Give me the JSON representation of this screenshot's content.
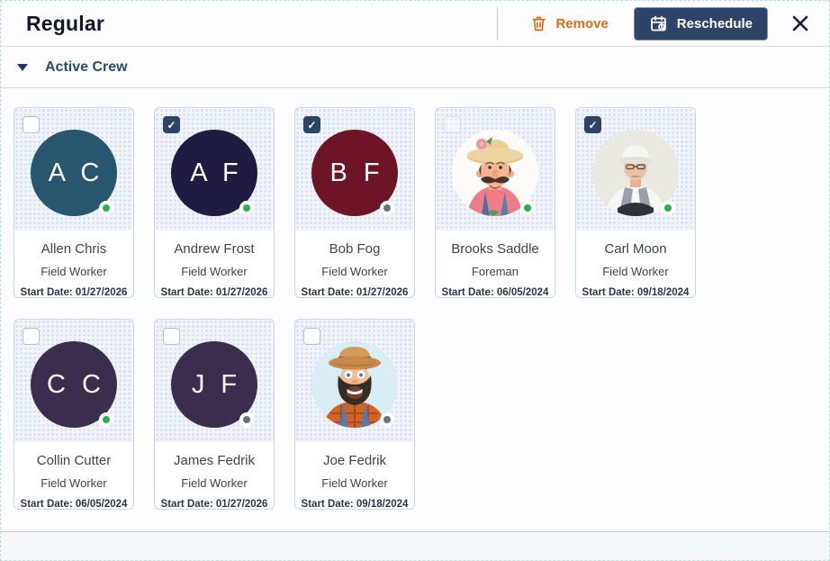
{
  "header": {
    "title": "Regular",
    "remove_label": "Remove",
    "reschedule_label": "Reschedule"
  },
  "section": {
    "title": "Active Crew"
  },
  "icons": {
    "remove": "trash-icon",
    "reschedule": "calendar-clock-icon",
    "close": "close-icon",
    "section_toggle": "chevron-down-icon",
    "check_glyph": "✓"
  },
  "colors": {
    "accent_navy": "#2e4467",
    "remove_orange": "#e5690f",
    "status_online": "#26b343",
    "status_offline": "#68707c",
    "section_title": "#2c4a6e",
    "card_border": "#c8d7e9"
  },
  "crew": [
    {
      "name": "Allen Chris",
      "role": "Field Worker",
      "start_date": "Start Date: 01/27/2026",
      "avatar": "initials",
      "initials": "A C",
      "avatar_color": "#27566e",
      "status": "online",
      "checked": false,
      "checkbox_faded": false
    },
    {
      "name": "Andrew Frost",
      "role": "Field Worker",
      "start_date": "Start Date: 01/27/2026",
      "avatar": "initials",
      "initials": "A F",
      "avatar_color": "#1f1b41",
      "status": "online",
      "checked": true,
      "checkbox_faded": false
    },
    {
      "name": "Bob Fog",
      "role": "Field Worker",
      "start_date": "Start Date: 01/27/2026",
      "avatar": "initials",
      "initials": "B F",
      "avatar_color": "#6d1426",
      "status": "offline",
      "checked": true,
      "checkbox_faded": false
    },
    {
      "name": "Brooks Saddle",
      "role": "Foreman",
      "start_date": "Start Date: 06/05/2024",
      "avatar": "farmer-mustache",
      "initials": "",
      "avatar_color": "#fdfbf8",
      "status": "online",
      "checked": false,
      "checkbox_faded": true
    },
    {
      "name": "Carl Moon",
      "role": "Field Worker",
      "start_date": "Start Date: 09/18/2024",
      "avatar": "hardhat-worker",
      "initials": "",
      "avatar_color": "#e9e9e1",
      "status": "online",
      "checked": true,
      "checkbox_faded": false
    },
    {
      "name": "Collin Cutter",
      "role": "Field Worker",
      "start_date": "Start Date: 06/05/2024",
      "avatar": "initials",
      "initials": "C C",
      "avatar_color": "#3a2d4e",
      "status": "online",
      "checked": false,
      "checkbox_faded": false
    },
    {
      "name": "James Fedrik",
      "role": "Field Worker",
      "start_date": "Start Date: 01/27/2026",
      "avatar": "initials",
      "initials": "J F",
      "avatar_color": "#3a2d4e",
      "status": "offline",
      "checked": false,
      "checkbox_faded": false
    },
    {
      "name": "Joe Fedrik",
      "role": "Field Worker",
      "start_date": "Start Date: 09/18/2024",
      "avatar": "farmer-beard",
      "initials": "",
      "avatar_color": "#d8eef4",
      "status": "offline",
      "checked": false,
      "checkbox_faded": false
    }
  ]
}
